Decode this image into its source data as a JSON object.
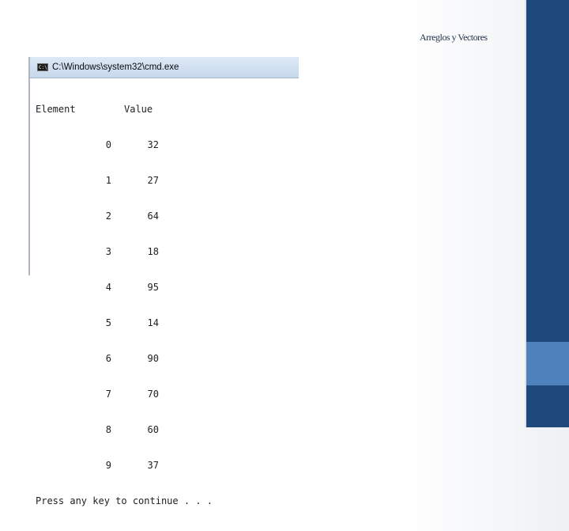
{
  "slide": {
    "title": "Arreglos y Vectores"
  },
  "window": {
    "title": "C:\\Windows\\system32\\cmd.exe",
    "icon": "cmd-icon"
  },
  "console": {
    "headers": {
      "element": "Element",
      "value": "Value"
    },
    "rows": [
      {
        "element": "0",
        "value": "32"
      },
      {
        "element": "1",
        "value": "27"
      },
      {
        "element": "2",
        "value": "64"
      },
      {
        "element": "3",
        "value": "18"
      },
      {
        "element": "4",
        "value": "95"
      },
      {
        "element": "5",
        "value": "14"
      },
      {
        "element": "6",
        "value": "90"
      },
      {
        "element": "7",
        "value": "70"
      },
      {
        "element": "8",
        "value": "60"
      },
      {
        "element": "9",
        "value": "37"
      }
    ],
    "prompt": "Press any key to continue . . ."
  },
  "colors": {
    "sidebar": "#1f497d",
    "accent": "#4f81bd"
  }
}
